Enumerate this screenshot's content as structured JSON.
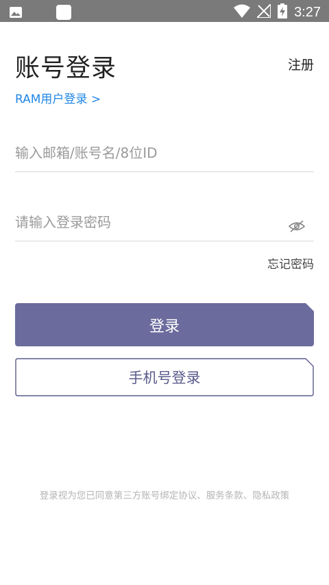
{
  "status_bar": {
    "time": "3:27",
    "icons": [
      "image-icon",
      "square-icon",
      "wifi-icon",
      "no-signal-icon",
      "battery-charging-icon"
    ]
  },
  "header": {
    "title": "账号登录",
    "register_label": "注册"
  },
  "ram_link": "RAM用户登录 >",
  "form": {
    "account_placeholder": "输入邮箱/账号名/8位ID",
    "password_placeholder": "请输入登录密码",
    "forgot_label": "忘记密码"
  },
  "buttons": {
    "login_label": "登录",
    "phone_login_label": "手机号登录"
  },
  "agreement": "登录视为您已同意第三方账号绑定协议、服务条款、隐私政策",
  "colors": {
    "primary": "#6b6b9d",
    "link": "#1f86e6",
    "status_bar": "#7a7a7a"
  }
}
